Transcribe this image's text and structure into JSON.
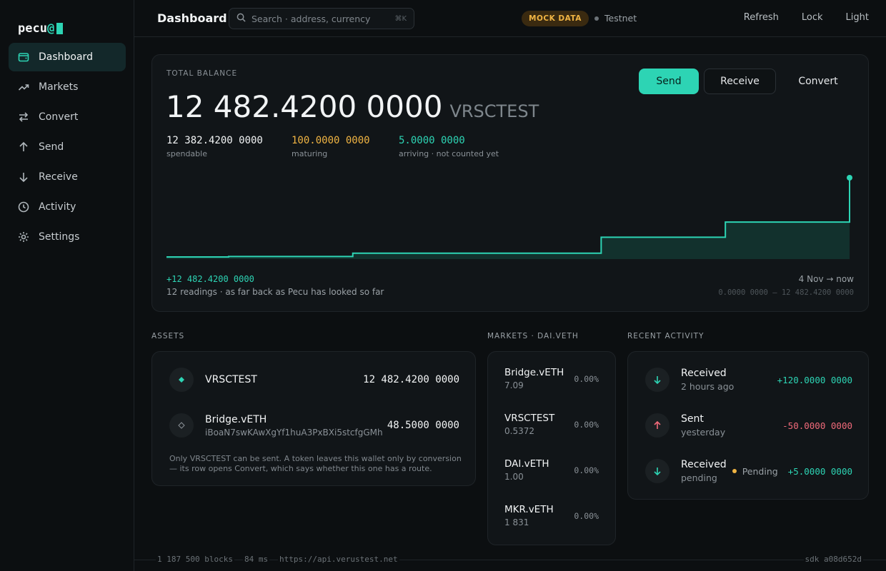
{
  "brand": {
    "name": "pecu",
    "at": "@"
  },
  "sidebar": {
    "items": [
      {
        "label": "Dashboard",
        "icon": "wallet-icon",
        "active": true
      },
      {
        "label": "Markets",
        "icon": "trending-up-icon"
      },
      {
        "label": "Convert",
        "icon": "swap-icon"
      },
      {
        "label": "Send",
        "icon": "arrow-up-icon"
      },
      {
        "label": "Receive",
        "icon": "arrow-down-icon"
      },
      {
        "label": "Activity",
        "icon": "clock-icon"
      },
      {
        "label": "Settings",
        "icon": "gear-icon"
      }
    ]
  },
  "header": {
    "title": "Dashboard",
    "search_placeholder": "Search · address, currency",
    "search_shortcut": "⌘K",
    "mock_badge": "MOCK DATA",
    "network": "Testnet",
    "actions": [
      "Refresh",
      "Lock",
      "Light"
    ]
  },
  "balance": {
    "label": "TOTAL BALANCE",
    "amount": "12 482.4200 0000",
    "currency": "VRSCTEST",
    "spendable": {
      "value": "12 382.4200 0000",
      "label": "spendable"
    },
    "maturing": {
      "value": "100.0000 0000",
      "label": "maturing"
    },
    "arriving": {
      "value": "5.0000 0000",
      "label": "arriving · not counted yet"
    },
    "buttons": {
      "send": "Send",
      "receive": "Receive",
      "convert": "Convert"
    },
    "gain": "+12 482.4200 0000",
    "note": "12 readings · as far back as Pecu has looked so far",
    "range": "4 Nov → now",
    "minmax": "0.0000 0000 – 12 482.4200 0000"
  },
  "chart_data": {
    "type": "area",
    "step": true,
    "values": [
      0,
      70,
      70,
      590,
      590,
      590,
      590,
      3100,
      3100,
      5500,
      5500,
      12482.42
    ],
    "ylim": [
      0,
      12482.42
    ],
    "color": "#2dd4b4"
  },
  "sections": {
    "assets": "ASSETS",
    "markets": "MARKETS · DAI.vETH",
    "activity": "RECENT ACTIVITY"
  },
  "assets": {
    "rows": [
      {
        "name": "VRSCTEST",
        "address": "",
        "amount": "12 482.4200 0000"
      },
      {
        "name": "Bridge.vETH",
        "address": "iBoaN7swKAwXgYf1huA3PxBXi5stcfgGMh",
        "amount": "48.5000 0000"
      }
    ],
    "note": "Only VRSCTEST can be sent. A token leaves this wallet only by conversion — its row opens Convert, which says whether this one has a route."
  },
  "markets": {
    "rows": [
      {
        "name": "Bridge.vETH",
        "price": "7.09",
        "change": "0.00%"
      },
      {
        "name": "VRSCTEST",
        "price": "0.5372",
        "change": "0.00%"
      },
      {
        "name": "DAI.vETH",
        "price": "1.00",
        "change": "0.00%"
      },
      {
        "name": "MKR.vETH",
        "price": "1 831",
        "change": "0.00%"
      }
    ]
  },
  "activity": {
    "rows": [
      {
        "title": "Received",
        "time": "2 hours ago",
        "amount": "+120.0000 0000",
        "direction": "in"
      },
      {
        "title": "Sent",
        "time": "yesterday",
        "amount": "-50.0000 0000",
        "direction": "out"
      },
      {
        "title": "Received",
        "time": "pending",
        "status": "Pending",
        "amount": "+5.0000 0000",
        "direction": "in"
      }
    ]
  },
  "status": {
    "blocks": "1 187 500 blocks",
    "latency": "84 ms",
    "api": "https://api.verustest.net",
    "sdk": "sdk a08d652d"
  },
  "colors": {
    "accent": "#2dd4b4",
    "warn": "#f0b443",
    "negative": "#f06a7a"
  }
}
